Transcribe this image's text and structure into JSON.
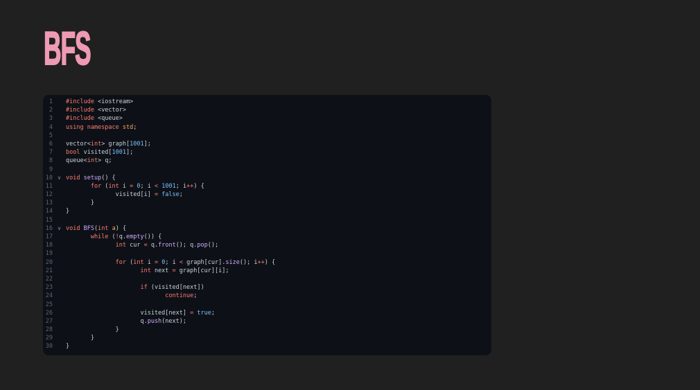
{
  "page": {
    "background_color": "#202020"
  },
  "header": {
    "title": "BFS",
    "title_color": "#ef9ab4"
  },
  "editor": {
    "background_color": "#0d1117",
    "line_number_color": "#5c6570",
    "fold_icon_glyph": "∨",
    "syntax_colors": {
      "keyword": "#ff7b72",
      "function": "#d2a8ff",
      "constant": "#79c0ff",
      "plain": "#c9d1d9",
      "namespace": "#ffa657"
    },
    "lines": [
      {
        "n": "1",
        "fold": false,
        "tokens": [
          [
            "k",
            "#include"
          ],
          [
            "p",
            " <iostream>"
          ]
        ]
      },
      {
        "n": "2",
        "fold": false,
        "tokens": [
          [
            "k",
            "#include"
          ],
          [
            "p",
            " <vector>"
          ]
        ]
      },
      {
        "n": "3",
        "fold": false,
        "tokens": [
          [
            "k",
            "#include"
          ],
          [
            "p",
            " <queue>"
          ]
        ]
      },
      {
        "n": "4",
        "fold": false,
        "tokens": [
          [
            "k",
            "using"
          ],
          [
            "p",
            " "
          ],
          [
            "k",
            "namespace"
          ],
          [
            "p",
            " "
          ],
          [
            "t",
            "std"
          ],
          [
            "p",
            ";"
          ]
        ]
      },
      {
        "n": "5",
        "fold": false,
        "tokens": []
      },
      {
        "n": "6",
        "fold": false,
        "tokens": [
          [
            "p",
            "vector<"
          ],
          [
            "k",
            "int"
          ],
          [
            "p",
            "> graph["
          ],
          [
            "n",
            "1001"
          ],
          [
            "p",
            "];"
          ]
        ]
      },
      {
        "n": "7",
        "fold": false,
        "tokens": [
          [
            "k",
            "bool"
          ],
          [
            "p",
            " visited["
          ],
          [
            "n",
            "1001"
          ],
          [
            "p",
            "];"
          ]
        ]
      },
      {
        "n": "8",
        "fold": false,
        "tokens": [
          [
            "p",
            "queue<"
          ],
          [
            "k",
            "int"
          ],
          [
            "p",
            "> q;"
          ]
        ]
      },
      {
        "n": "9",
        "fold": false,
        "tokens": []
      },
      {
        "n": "10",
        "fold": true,
        "tokens": [
          [
            "k",
            "void"
          ],
          [
            "p",
            " "
          ],
          [
            "f",
            "setup"
          ],
          [
            "p",
            "() {"
          ]
        ]
      },
      {
        "n": "11",
        "fold": false,
        "tokens": [
          [
            "p",
            "       "
          ],
          [
            "k",
            "for"
          ],
          [
            "p",
            " ("
          ],
          [
            "k",
            "int"
          ],
          [
            "p",
            " i "
          ],
          [
            "k",
            "="
          ],
          [
            "p",
            " "
          ],
          [
            "n",
            "0"
          ],
          [
            "p",
            "; i "
          ],
          [
            "k",
            "<"
          ],
          [
            "p",
            " "
          ],
          [
            "n",
            "1001"
          ],
          [
            "p",
            "; i"
          ],
          [
            "k",
            "++"
          ],
          [
            "p",
            ") {"
          ]
        ]
      },
      {
        "n": "12",
        "fold": false,
        "tokens": [
          [
            "p",
            "              visited[i] "
          ],
          [
            "k",
            "="
          ],
          [
            "p",
            " "
          ],
          [
            "n",
            "false"
          ],
          [
            "p",
            ";"
          ]
        ]
      },
      {
        "n": "13",
        "fold": false,
        "tokens": [
          [
            "p",
            "       }"
          ]
        ]
      },
      {
        "n": "14",
        "fold": false,
        "tokens": [
          [
            "p",
            "}"
          ]
        ]
      },
      {
        "n": "15",
        "fold": false,
        "tokens": []
      },
      {
        "n": "16",
        "fold": true,
        "tokens": [
          [
            "k",
            "void"
          ],
          [
            "p",
            " "
          ],
          [
            "f",
            "BFS"
          ],
          [
            "p",
            "("
          ],
          [
            "k",
            "int"
          ],
          [
            "p",
            " "
          ],
          [
            "t",
            "a"
          ],
          [
            "p",
            ") {"
          ]
        ]
      },
      {
        "n": "17",
        "fold": false,
        "tokens": [
          [
            "p",
            "       "
          ],
          [
            "k",
            "while"
          ],
          [
            "p",
            " ("
          ],
          [
            "k",
            "!"
          ],
          [
            "p",
            "q."
          ],
          [
            "f",
            "empty"
          ],
          [
            "p",
            "()) {"
          ]
        ]
      },
      {
        "n": "18",
        "fold": false,
        "tokens": [
          [
            "p",
            "              "
          ],
          [
            "k",
            "int"
          ],
          [
            "p",
            " cur "
          ],
          [
            "k",
            "="
          ],
          [
            "p",
            " q."
          ],
          [
            "f",
            "front"
          ],
          [
            "p",
            "(); q."
          ],
          [
            "f",
            "pop"
          ],
          [
            "p",
            "();"
          ]
        ]
      },
      {
        "n": "19",
        "fold": false,
        "tokens": []
      },
      {
        "n": "20",
        "fold": false,
        "tokens": [
          [
            "p",
            "              "
          ],
          [
            "k",
            "for"
          ],
          [
            "p",
            " ("
          ],
          [
            "k",
            "int"
          ],
          [
            "p",
            " i "
          ],
          [
            "k",
            "="
          ],
          [
            "p",
            " "
          ],
          [
            "n",
            "0"
          ],
          [
            "p",
            "; i "
          ],
          [
            "k",
            "<"
          ],
          [
            "p",
            " graph[cur]."
          ],
          [
            "f",
            "size"
          ],
          [
            "p",
            "(); i"
          ],
          [
            "k",
            "++"
          ],
          [
            "p",
            ") {"
          ]
        ]
      },
      {
        "n": "21",
        "fold": false,
        "tokens": [
          [
            "p",
            "                     "
          ],
          [
            "k",
            "int"
          ],
          [
            "p",
            " next "
          ],
          [
            "k",
            "="
          ],
          [
            "p",
            " graph[cur][i];"
          ]
        ]
      },
      {
        "n": "22",
        "fold": false,
        "tokens": []
      },
      {
        "n": "23",
        "fold": false,
        "tokens": [
          [
            "p",
            "                     "
          ],
          [
            "k",
            "if"
          ],
          [
            "p",
            " (visited[next])"
          ]
        ]
      },
      {
        "n": "24",
        "fold": false,
        "tokens": [
          [
            "p",
            "                            "
          ],
          [
            "k",
            "continue"
          ],
          [
            "p",
            ";"
          ]
        ]
      },
      {
        "n": "25",
        "fold": false,
        "tokens": []
      },
      {
        "n": "26",
        "fold": false,
        "tokens": [
          [
            "p",
            "                     visited[next] "
          ],
          [
            "k",
            "="
          ],
          [
            "p",
            " "
          ],
          [
            "n",
            "true"
          ],
          [
            "p",
            ";"
          ]
        ]
      },
      {
        "n": "27",
        "fold": false,
        "tokens": [
          [
            "p",
            "                     q."
          ],
          [
            "f",
            "push"
          ],
          [
            "p",
            "(next);"
          ]
        ]
      },
      {
        "n": "28",
        "fold": false,
        "tokens": [
          [
            "p",
            "              }"
          ]
        ]
      },
      {
        "n": "29",
        "fold": false,
        "tokens": [
          [
            "p",
            "       }"
          ]
        ]
      },
      {
        "n": "30",
        "fold": false,
        "tokens": [
          [
            "p",
            "}"
          ]
        ]
      }
    ]
  }
}
